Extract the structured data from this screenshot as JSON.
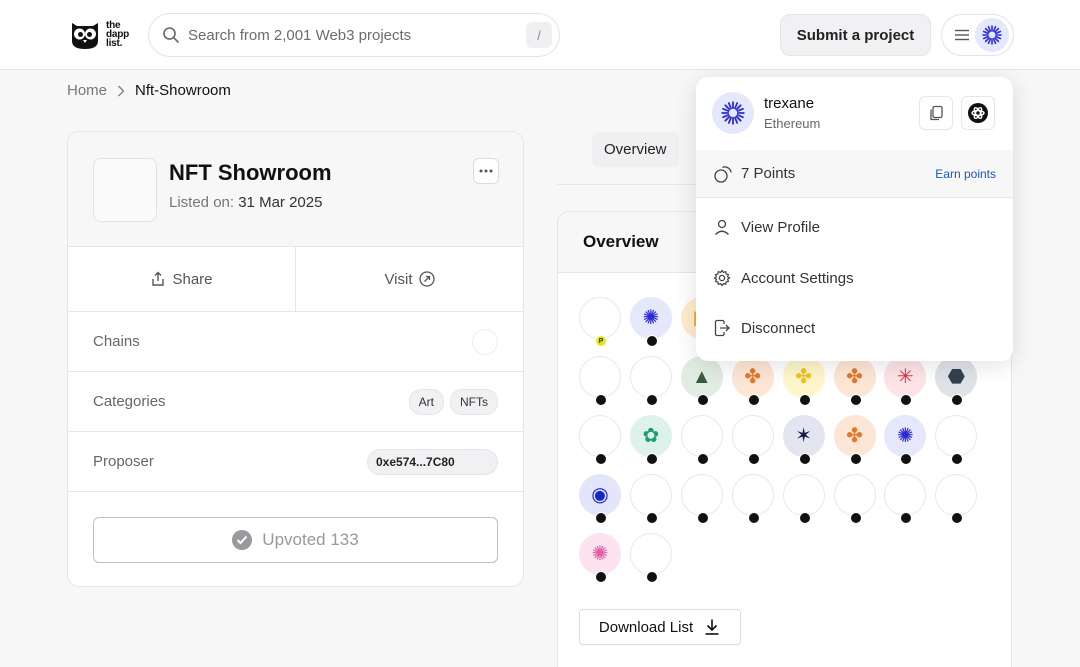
{
  "header": {
    "logo_text": [
      "the",
      "dapp",
      "list."
    ],
    "search_placeholder": "Search from 2,001 Web3 projects",
    "search_shortcut": "/",
    "submit_label": "Submit a project"
  },
  "breadcrumb": {
    "home": "Home",
    "current": "Nft-Showroom"
  },
  "project": {
    "name": "NFT Showroom",
    "listed_label": "Listed on:",
    "listed_date": "31 Mar 2025",
    "share_label": "Share",
    "visit_label": "Visit",
    "chains_label": "Chains",
    "categories_label": "Categories",
    "categories": [
      "Art",
      "NFTs"
    ],
    "proposer_label": "Proposer",
    "proposer_address": "0xe574...7C80",
    "upvote_label": "Upvoted 133"
  },
  "tabs": {
    "overview": "Overview"
  },
  "overview_card": {
    "title": "Overview",
    "download_label": "Download List"
  },
  "upvoters": [
    {
      "color": "#ffffff",
      "glyph": "",
      "badge": "P"
    },
    {
      "color": "#e5e7fb",
      "glyph": "✺",
      "glyph_color": "#2b2bd6"
    },
    {
      "color": "#ffeccc",
      "glyph": "▶",
      "glyph_color": "#e8b021"
    },
    {
      "color": "#ffffff",
      "glyph": ""
    },
    {
      "color": "#ffffff",
      "glyph": ""
    },
    {
      "color": "#ffffff",
      "glyph": ""
    },
    {
      "color": "#ffffff",
      "glyph": ""
    },
    {
      "color": "#ffffff",
      "glyph": ""
    },
    {
      "color": "#ffffff",
      "glyph": ""
    },
    {
      "color": "#ffffff",
      "glyph": ""
    },
    {
      "color": "#e1ece3",
      "glyph": "▲",
      "glyph_color": "#375c3c"
    },
    {
      "color": "#fde6d6",
      "glyph": "✤",
      "glyph_color": "#e07a2e"
    },
    {
      "color": "#fff6cc",
      "glyph": "✤",
      "glyph_color": "#f0c419"
    },
    {
      "color": "#fde6d6",
      "glyph": "✤",
      "glyph_color": "#e07a2e"
    },
    {
      "color": "#fde4e6",
      "glyph": "✳",
      "glyph_color": "#e03246"
    },
    {
      "color": "#dfe3e8",
      "glyph": "⬣",
      "glyph_color": "#34404d"
    },
    {
      "color": "#ffffff",
      "glyph": ""
    },
    {
      "color": "#ddf3ea",
      "glyph": "✿",
      "glyph_color": "#1f9c7a"
    },
    {
      "color": "#ffffff",
      "glyph": ""
    },
    {
      "color": "#ffffff",
      "glyph": ""
    },
    {
      "color": "#e3e5f1",
      "glyph": "✶",
      "glyph_color": "#121a4a"
    },
    {
      "color": "#fde6d6",
      "glyph": "✤",
      "glyph_color": "#e07a2e"
    },
    {
      "color": "#e5e7fb",
      "glyph": "✺",
      "glyph_color": "#2b2bd6"
    },
    {
      "color": "#ffffff",
      "glyph": ""
    },
    {
      "color": "#e3e6fb",
      "glyph": "◉",
      "glyph_color": "#1b24c4"
    },
    {
      "color": "#ffffff",
      "glyph": ""
    },
    {
      "color": "#ffffff",
      "glyph": ""
    },
    {
      "color": "#ffffff",
      "glyph": ""
    },
    {
      "color": "#ffffff",
      "glyph": ""
    },
    {
      "color": "#ffffff",
      "glyph": ""
    },
    {
      "color": "#ffffff",
      "glyph": ""
    },
    {
      "color": "#ffffff",
      "glyph": ""
    },
    {
      "color": "#fde3ef",
      "glyph": "✺",
      "glyph_color": "#e35fa7"
    },
    {
      "color": "#ffffff",
      "glyph": ""
    }
  ],
  "dropdown": {
    "user_name": "trexane",
    "user_chain": "Ethereum",
    "points": "7 Points",
    "earn_label": "Earn points",
    "view_profile": "View Profile",
    "account_settings": "Account Settings",
    "disconnect": "Disconnect"
  },
  "colors": {
    "accent_blue": "#1a56c4",
    "avatar_blue": "#2b2bd6"
  }
}
